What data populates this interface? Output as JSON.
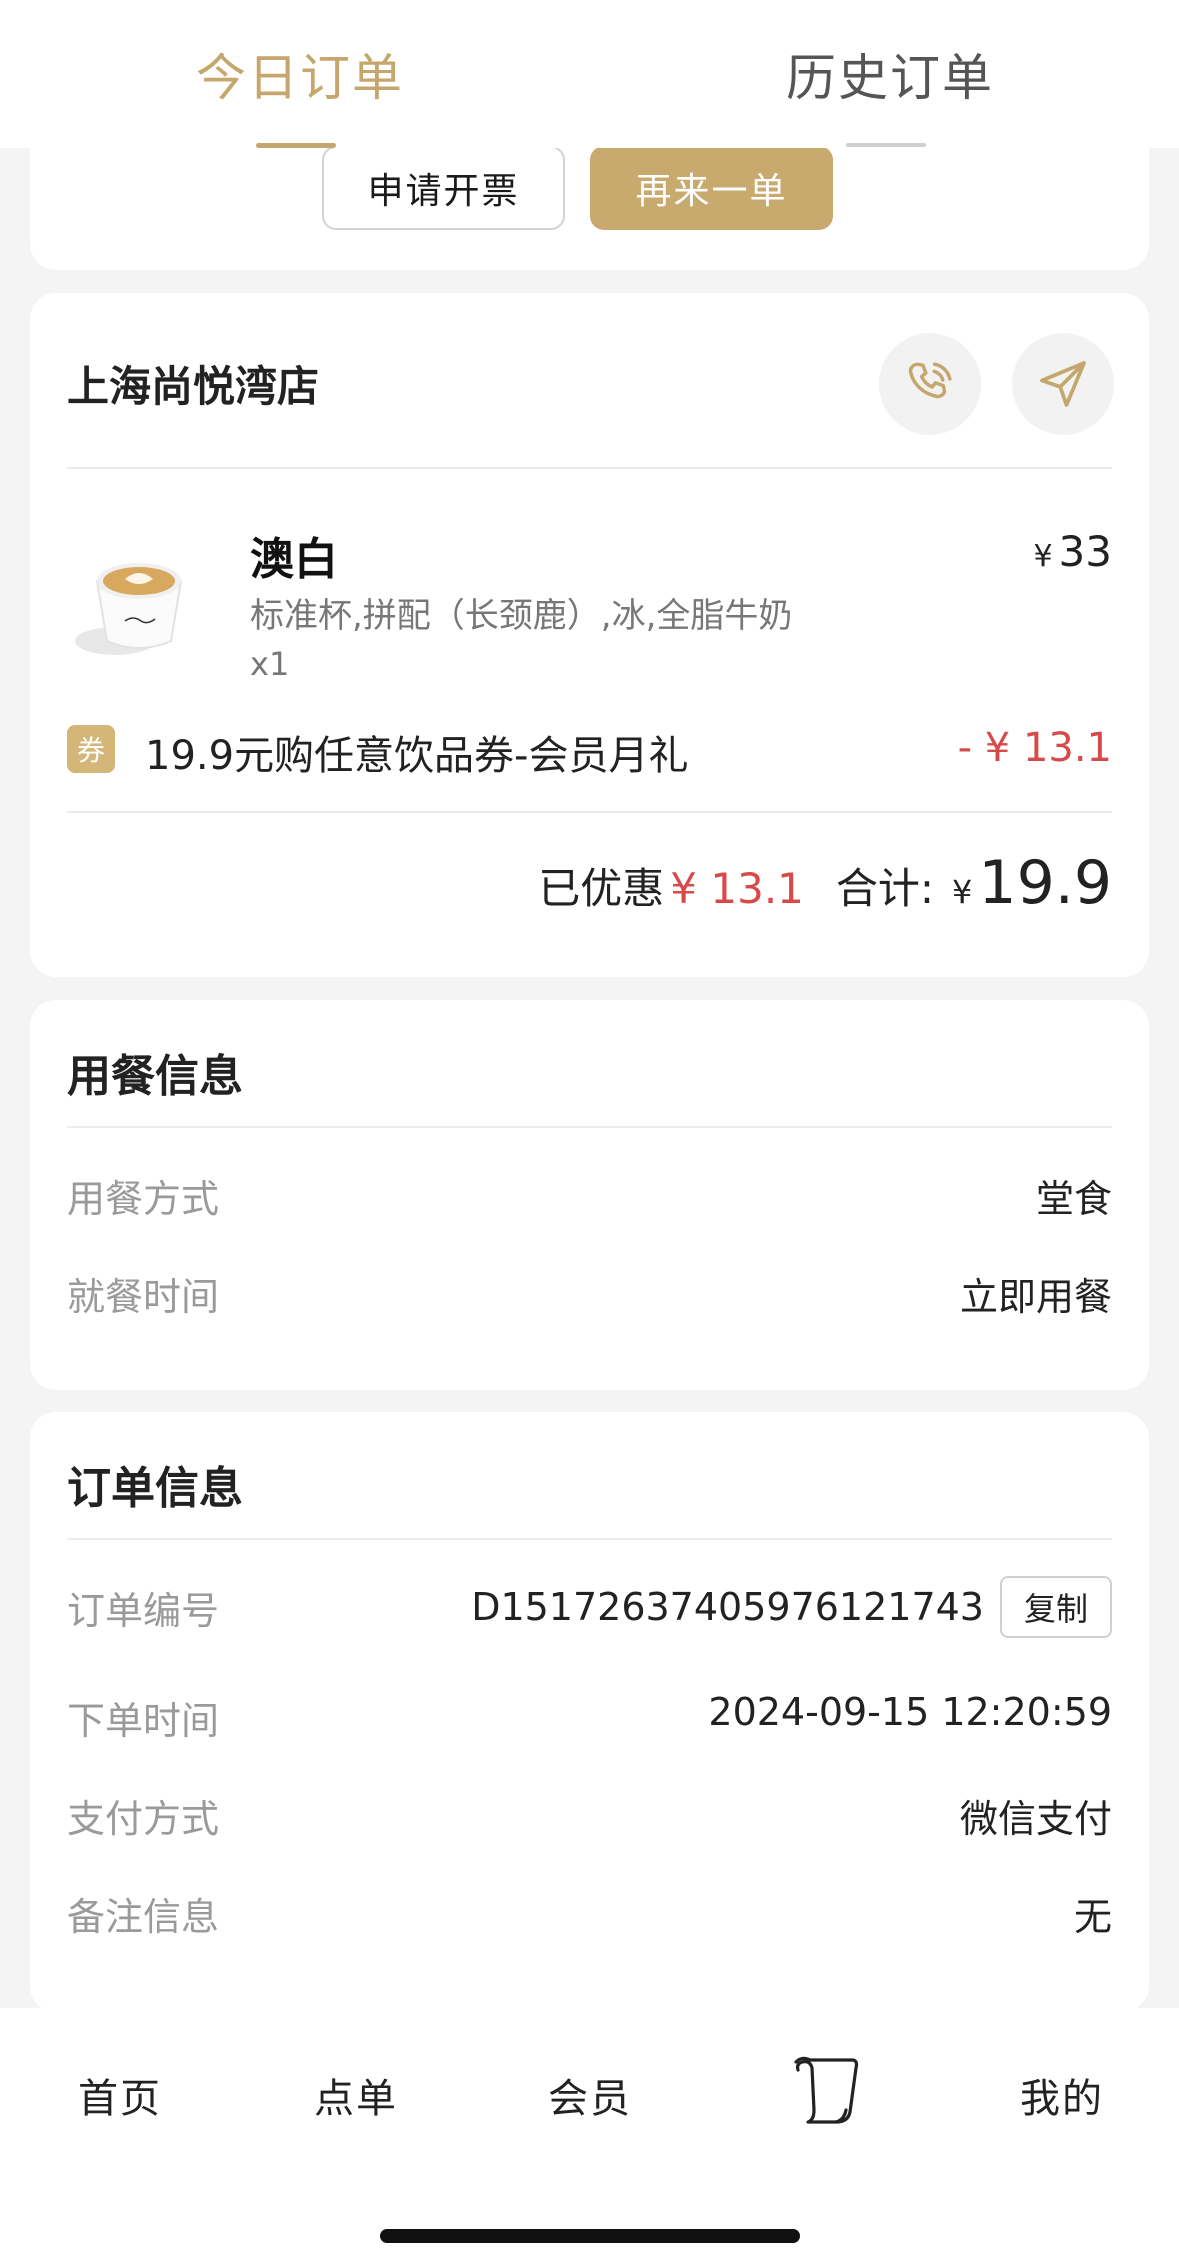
{
  "tabs": {
    "today": "今日订单",
    "history": "历史订单"
  },
  "actions": {
    "invoice": "申请开票",
    "reorder": "再来一单"
  },
  "store": {
    "name": "上海尚悦湾店",
    "call_icon": "phone-icon",
    "navigate_icon": "navigate-icon"
  },
  "product": {
    "name": "澳白",
    "spec": "标准杯,拼配（长颈鹿）,冰,全脂牛奶",
    "qty": "x1",
    "price_symbol": "¥",
    "price": "33"
  },
  "coupon": {
    "tag": "券",
    "text": "19.9元购任意饮品券-会员月礼",
    "amount": "- ¥ 13.1"
  },
  "summary": {
    "discount_label": "已优惠",
    "discount_value": "¥ 13.1",
    "total_label": "合计:",
    "total_symbol": "¥",
    "total_value": "19.9"
  },
  "dining": {
    "title": "用餐信息",
    "rows": [
      {
        "label": "用餐方式",
        "value": "堂食"
      },
      {
        "label": "就餐时间",
        "value": "立即用餐"
      }
    ]
  },
  "order": {
    "title": "订单信息",
    "number_label": "订单编号",
    "number_value": "D1517263740597612174​3",
    "copy_label": "复制",
    "rows": [
      {
        "label": "下单时间",
        "value": "2024-09-15 12:20:59"
      },
      {
        "label": "支付方式",
        "value": "微信支付"
      },
      {
        "label": "备注信息",
        "value": "无"
      }
    ]
  },
  "bottom_nav": {
    "home": "首页",
    "menu": "点单",
    "member": "会员",
    "orders_icon": "scroll-icon",
    "mine": "我的"
  },
  "colors": {
    "accent": "#c5a76d",
    "discount": "#d8494a"
  }
}
